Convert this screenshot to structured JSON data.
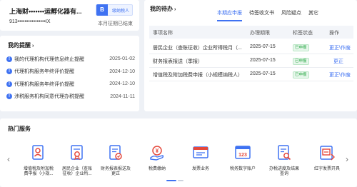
{
  "company": {
    "name": "上海财•••••••运孵化器有...",
    "tax_id": "913••••••••••••••••IX",
    "badge_letter": "B",
    "badge_text": "级纳税人",
    "period_status": "本月征期已结束"
  },
  "reminders": {
    "title": "我的提醒",
    "items": [
      {
        "text": "我的代理机构代理信息终止提醒",
        "date": "2025-01-02"
      },
      {
        "text": "代理机构服务年终评价提醒",
        "date": "2024-12-10"
      },
      {
        "text": "代理机构服务年终评价提醒",
        "date": "2024-12-10"
      },
      {
        "text": "涉税服务机构同意代理办税提醒",
        "date": "2024-11-11"
      }
    ]
  },
  "todo": {
    "title": "我的待办",
    "tabs": [
      "本期应申报",
      "待签收文书",
      "风险疑点",
      "其它"
    ],
    "active_tab": 0,
    "columns": {
      "name": "事项名称",
      "due": "办理期限",
      "status": "标签状态",
      "op": "操作"
    },
    "rows": [
      {
        "name": "居民企业（查账征收）企业所得税月（...",
        "due": "2025-07-15",
        "status": "已申报",
        "op": "更正\\作废"
      },
      {
        "name": "财务报表报送（季报）",
        "due": "2025-07-15",
        "status": "已申报",
        "op": "更正"
      },
      {
        "name": "增值税及附加税费申报（小规模纳税人）",
        "due": "2025-07-15",
        "status": "已申报",
        "op": "更正\\作废"
      }
    ]
  },
  "services": {
    "title": "热门服务",
    "items": [
      {
        "label1": "增值税及附加税",
        "label2": "费申报（小规...",
        "icon": "person-document-icon"
      },
      {
        "label1": "居民企业（查账",
        "label2": "征收）企业所...",
        "icon": "certificate-document-icon"
      },
      {
        "label1": "财务报表报送及",
        "label2": "更正",
        "icon": "report-document-icon"
      },
      {
        "label1": "税费缴纳",
        "label2": "",
        "icon": "tax-payment-icon"
      },
      {
        "label1": "发票业务",
        "label2": "",
        "icon": "invoice-icon"
      },
      {
        "label1": "税务数字账户",
        "label2": "",
        "icon": "digital-account-icon"
      },
      {
        "label1": "办税进度及结果",
        "label2": "查询",
        "icon": "progress-query-icon"
      },
      {
        "label1": "红字发票开具",
        "label2": "",
        "icon": "red-invoice-icon"
      }
    ],
    "pages": 2
  },
  "colors": {
    "accent": "#3f72f2",
    "success": "#27a844",
    "danger": "#e5483b"
  }
}
